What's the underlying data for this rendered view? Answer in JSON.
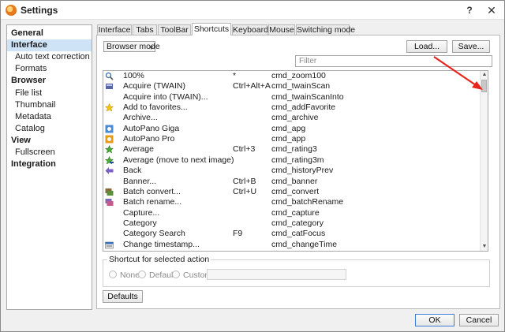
{
  "window": {
    "title": "Settings",
    "help_label": "?",
    "close_label": "✕"
  },
  "sidebar": {
    "items": [
      {
        "label": "General",
        "kind": "cat"
      },
      {
        "label": "Interface",
        "kind": "cat",
        "selected": true
      },
      {
        "label": "Auto text correction",
        "kind": "sub"
      },
      {
        "label": "Formats",
        "kind": "sub"
      },
      {
        "label": "Browser",
        "kind": "cat"
      },
      {
        "label": "File list",
        "kind": "sub"
      },
      {
        "label": "Thumbnail",
        "kind": "sub"
      },
      {
        "label": "Metadata",
        "kind": "sub"
      },
      {
        "label": "Catalog",
        "kind": "sub"
      },
      {
        "label": "View",
        "kind": "cat"
      },
      {
        "label": "Fullscreen",
        "kind": "sub"
      },
      {
        "label": "Integration",
        "kind": "cat"
      }
    ]
  },
  "tabs": [
    "Interface",
    "Tabs",
    "ToolBar",
    "Shortcuts",
    "Keyboard",
    "Mouse",
    "Switching mode"
  ],
  "active_tab": "Shortcuts",
  "toolbar": {
    "mode_value": "Browser mode",
    "load_label": "Load...",
    "save_label": "Save...",
    "filter_placeholder": "Filter"
  },
  "shortcuts": [
    {
      "icon": "magnifier-icon",
      "name": "100%",
      "key": "*",
      "cmd": "cmd_zoom100"
    },
    {
      "icon": "scanner-icon",
      "name": "Acquire (TWAIN)",
      "key": "Ctrl+Alt+A",
      "cmd": "cmd_twainScan"
    },
    {
      "icon": "",
      "name": "Acquire into (TWAIN)...",
      "key": "",
      "cmd": "cmd_twainScanInto"
    },
    {
      "icon": "star-icon",
      "name": "Add to favorites...",
      "key": "",
      "cmd": "cmd_addFavorite"
    },
    {
      "icon": "",
      "name": "Archive...",
      "key": "",
      "cmd": "cmd_archive"
    },
    {
      "icon": "autopano-giga-icon",
      "name": "AutoPano Giga",
      "key": "",
      "cmd": "cmd_apg"
    },
    {
      "icon": "autopano-pro-icon",
      "name": "AutoPano Pro",
      "key": "",
      "cmd": "cmd_app"
    },
    {
      "icon": "rating-star-icon",
      "name": "Average",
      "key": "Ctrl+3",
      "cmd": "cmd_rating3"
    },
    {
      "icon": "rating-star-minus-icon",
      "name": "Average (move to next image)",
      "key": "",
      "cmd": "cmd_rating3m"
    },
    {
      "icon": "back-arrow-icon",
      "name": "Back",
      "key": "",
      "cmd": "cmd_historyPrev"
    },
    {
      "icon": "",
      "name": "Banner...",
      "key": "Ctrl+B",
      "cmd": "cmd_banner"
    },
    {
      "icon": "batch-convert-icon",
      "name": "Batch convert...",
      "key": "Ctrl+U",
      "cmd": "cmd_convert"
    },
    {
      "icon": "batch-rename-icon",
      "name": "Batch rename...",
      "key": "",
      "cmd": "cmd_batchRename"
    },
    {
      "icon": "",
      "name": "Capture...",
      "key": "",
      "cmd": "cmd_capture"
    },
    {
      "icon": "",
      "name": "Category",
      "key": "",
      "cmd": "cmd_category"
    },
    {
      "icon": "",
      "name": "Category Search",
      "key": "F9",
      "cmd": "cmd_catFocus"
    },
    {
      "icon": "change-timestamp-icon",
      "name": "Change timestamp...",
      "key": "",
      "cmd": "cmd_changeTime"
    }
  ],
  "shortcut_group": {
    "label": "Shortcut for selected action",
    "none_label": "None",
    "default_label": "Default",
    "custom_label": "Custom"
  },
  "footer": {
    "defaults_label": "Defaults",
    "ok_label": "OK",
    "cancel_label": "Cancel"
  },
  "colors": {
    "selection": "#cfe3f7",
    "annotation_arrow": "#e8231c",
    "accent": "#3c7fd6"
  }
}
